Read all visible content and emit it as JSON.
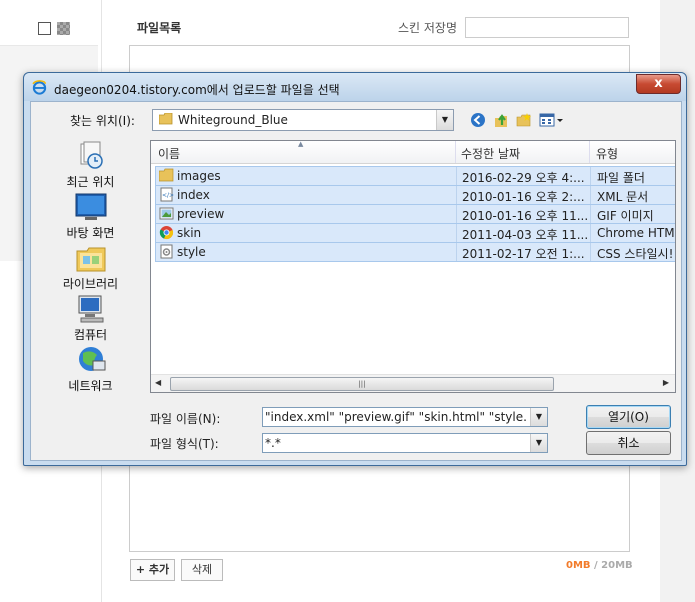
{
  "background": {
    "section_title": "파일목록",
    "skin_save_label": "스킨 저장명",
    "skin_save_value": "",
    "add_button": "+ 추가",
    "delete_button": "삭제",
    "quota_used": "0MB",
    "quota_sep": " / ",
    "quota_total": "20MB"
  },
  "dialog": {
    "title": "daegeon0204.tistory.com에서 업로드할 파일을 선택",
    "close_label": "x",
    "look_in_label": "찾는 위치(I):",
    "look_in_value": "Whiteground_Blue",
    "places": [
      {
        "label": "최근 위치",
        "icon": "recent-places-icon"
      },
      {
        "label": "바탕 화면",
        "icon": "desktop-icon"
      },
      {
        "label": "라이브러리",
        "icon": "libraries-icon"
      },
      {
        "label": "컴퓨터",
        "icon": "computer-icon"
      },
      {
        "label": "네트워크",
        "icon": "network-icon"
      }
    ],
    "columns": {
      "name": "이름",
      "date": "수정한 날짜",
      "type": "유형"
    },
    "files": [
      {
        "name": "images",
        "date": "2016-02-29 오후 4:...",
        "type": "파일 폴더",
        "icon": "folder-icon"
      },
      {
        "name": "index",
        "date": "2010-01-16 오후 2:...",
        "type": "XML 문서",
        "icon": "xml-file-icon"
      },
      {
        "name": "preview",
        "date": "2010-01-16 오후 11...",
        "type": "GIF 이미지",
        "icon": "gif-file-icon"
      },
      {
        "name": "skin",
        "date": "2011-04-03 오후 11...",
        "type": "Chrome HTML",
        "icon": "chrome-html-icon"
      },
      {
        "name": "style",
        "date": "2011-02-17 오전 1:...",
        "type": "CSS 스타일시!",
        "icon": "css-file-icon"
      }
    ],
    "file_name_label": "파일 이름(N):",
    "file_name_value": "\"index.xml\" \"preview.gif\" \"skin.html\" \"style.css\"",
    "file_type_label": "파일 형식(T):",
    "file_type_value": "*.*",
    "open_button": "열기(O)",
    "cancel_button": "취소"
  }
}
